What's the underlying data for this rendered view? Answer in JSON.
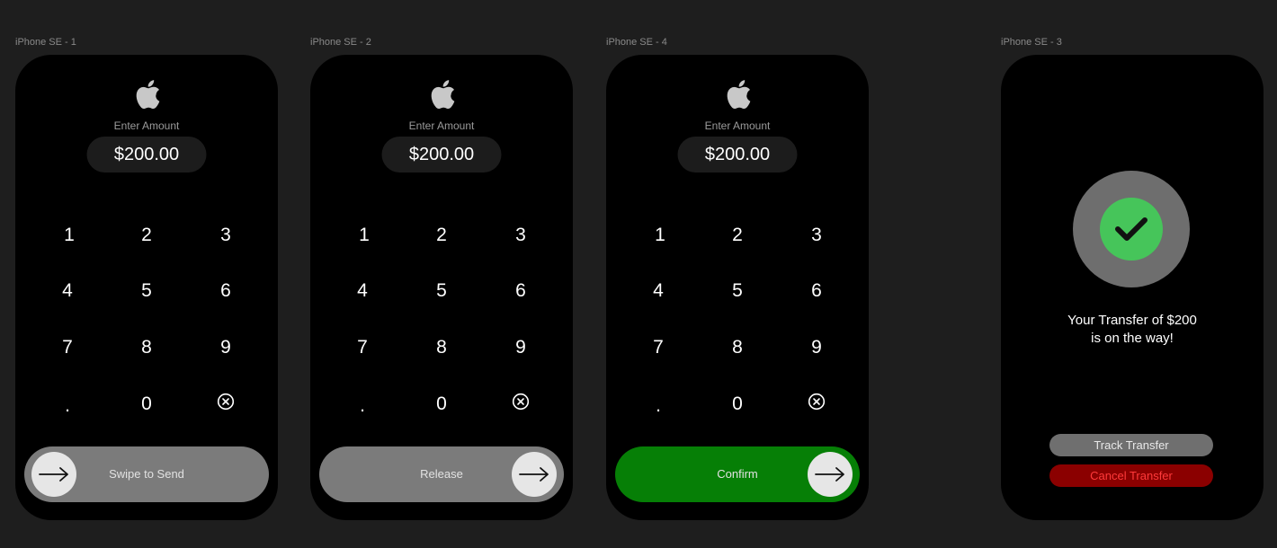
{
  "frames": [
    {
      "label": "iPhone SE - 1",
      "enter_label": "Enter Amount",
      "amount": "$200.00",
      "keys": [
        "1",
        "2",
        "3",
        "4",
        "5",
        "6",
        "7",
        "8",
        "9",
        ".",
        "0"
      ],
      "slider": {
        "label": "Swipe to Send",
        "state": "idle"
      }
    },
    {
      "label": "iPhone SE - 2",
      "enter_label": "Enter Amount",
      "amount": "$200.00",
      "keys": [
        "1",
        "2",
        "3",
        "4",
        "5",
        "6",
        "7",
        "8",
        "9",
        ".",
        "0"
      ],
      "slider": {
        "label": "Release",
        "state": "dragged"
      }
    },
    {
      "label": "iPhone SE - 4",
      "enter_label": "Enter Amount",
      "amount": "$200.00",
      "keys": [
        "1",
        "2",
        "3",
        "4",
        "5",
        "6",
        "7",
        "8",
        "9",
        ".",
        "0"
      ],
      "slider": {
        "label": "Confirm",
        "state": "confirm"
      }
    },
    {
      "label": "iPhone SE - 3",
      "success_line1": "Your Transfer of $200",
      "success_line2": "is on the way!",
      "track_button": "Track Transfer",
      "cancel_button": "Cancel Transfer"
    }
  ],
  "icons": {
    "logo": "apple-logo-icon",
    "delete": "circle-x-delete-icon",
    "arrow": "arrow-right-icon",
    "success": "checkmark-icon"
  },
  "colors": {
    "canvas": "#1e1e1e",
    "phone": "#000000",
    "slider_idle": "#7b7b7b",
    "slider_confirm": "#067f06",
    "success_green": "#46c55a",
    "cancel_bg": "#8b0000",
    "cancel_text": "#ff3a3a"
  }
}
